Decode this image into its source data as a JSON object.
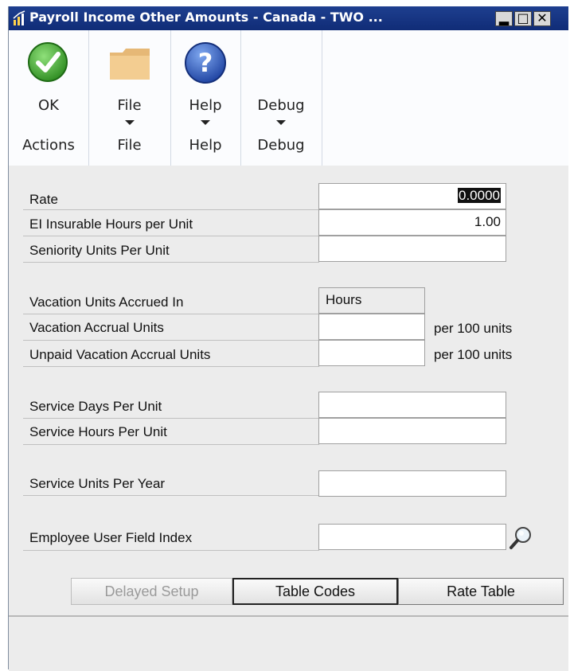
{
  "window": {
    "title": "Payroll Income Other Amounts - Canada  -  TWO ...",
    "controls": {
      "minimize": "▂",
      "maximize": "□",
      "close": "✕"
    }
  },
  "ribbon": {
    "groups": [
      {
        "button": "OK",
        "group": "Actions",
        "icon": "check-icon"
      },
      {
        "button": "File",
        "group": "File",
        "icon": "folder-icon"
      },
      {
        "button": "Help",
        "group": "Help",
        "icon": "help-icon"
      },
      {
        "button": "Debug",
        "group": "Debug",
        "icon": ""
      }
    ]
  },
  "fields": {
    "rate": {
      "label": "Rate",
      "value": "0.0000"
    },
    "ei_hours": {
      "label": "EI Insurable Hours per Unit",
      "value": "1.00"
    },
    "seniority": {
      "label": "Seniority Units Per Unit",
      "value": ""
    },
    "vac_in": {
      "label": "Vacation Units Accrued In",
      "value": "Hours"
    },
    "vac_units": {
      "label": "Vacation Accrual Units",
      "value": "",
      "unit": "per 100 units"
    },
    "unpaid_vac": {
      "label": "Unpaid Vacation Accrual Units",
      "value": "",
      "unit": "per 100 units"
    },
    "svc_days": {
      "label": "Service Days Per Unit",
      "value": ""
    },
    "svc_hours": {
      "label": "Service Hours Per Unit",
      "value": ""
    },
    "svc_year": {
      "label": "Service Units Per Year",
      "value": ""
    },
    "user_field": {
      "label": "Employee User Field Index",
      "value": ""
    }
  },
  "buttons": {
    "delayed_setup": "Delayed Setup",
    "table_codes": "Table Codes",
    "rate_table": "Rate Table"
  }
}
